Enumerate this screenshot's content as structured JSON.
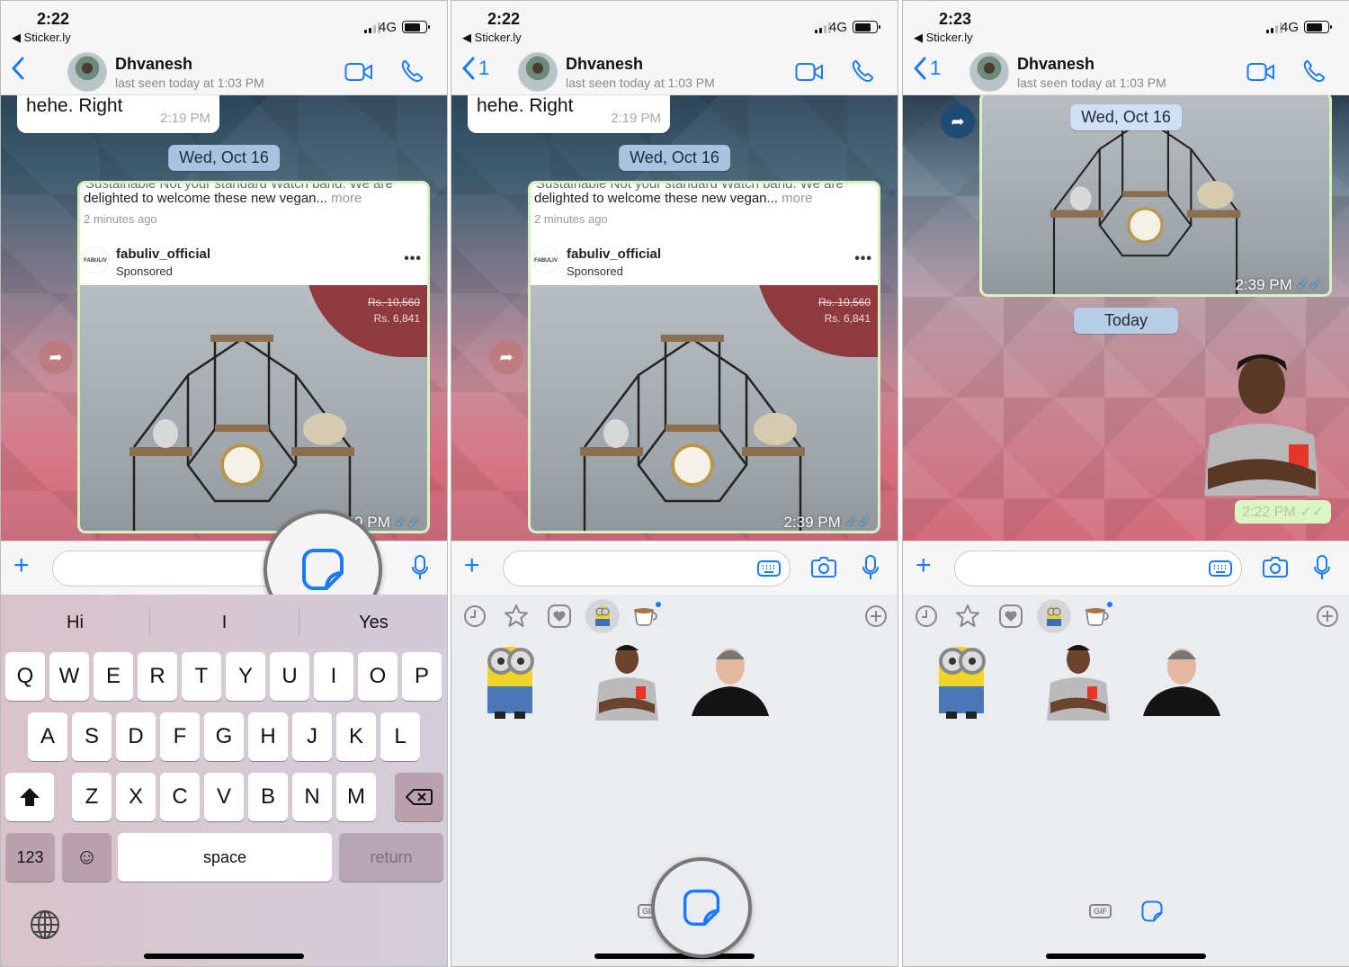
{
  "panels": [
    {
      "status": {
        "time": "2:22",
        "back_app": "◀ Sticker.ly",
        "network": "4G"
      },
      "header": {
        "back_label": "",
        "contact_name": "Dhvanesh",
        "last_seen": "last seen today at 1:03 PM"
      },
      "chat": {
        "incoming": {
          "text": "hehe. Right",
          "time": "2:19 PM"
        },
        "date_pill": "Wed, Oct 16",
        "card": {
          "cut_text": "Sustainable Not your standard Watch band. We are",
          "description": "delighted to welcome these new vegan...",
          "more": " more",
          "ago": "2 minutes ago",
          "logo_text": "FABULIV",
          "account": "fabuliv_official",
          "sponsored": "Sponsored",
          "menu": "•••",
          "old_price": "Rs. 10,560",
          "new_price": "Rs. 6,841",
          "time": "2:39 PM",
          "ticks": "✓✓"
        }
      },
      "input": {
        "placeholder": "",
        "value": ""
      },
      "suggestions": [
        "Hi",
        "I",
        "Yes"
      ],
      "keyboard": {
        "row1": [
          "Q",
          "W",
          "E",
          "R",
          "T",
          "Y",
          "U",
          "I",
          "O",
          "P"
        ],
        "row2": [
          "A",
          "S",
          "D",
          "F",
          "G",
          "H",
          "J",
          "K",
          "L"
        ],
        "row3": [
          "Z",
          "X",
          "C",
          "V",
          "B",
          "N",
          "M"
        ],
        "numbers": "123",
        "space": "space",
        "return": "return"
      }
    },
    {
      "status": {
        "time": "2:22",
        "back_app": "◀ Sticker.ly",
        "network": "4G"
      },
      "header": {
        "back_label": "1",
        "contact_name": "Dhvanesh",
        "last_seen": "last seen today at 1:03 PM"
      },
      "chat": {
        "incoming": {
          "text": "hehe. Right",
          "time": "2:19 PM"
        },
        "date_pill": "Wed, Oct 16",
        "card": {
          "cut_text": "Sustainable Not your standard Watch band. We are",
          "description": "delighted to welcome these new vegan...",
          "more": " more",
          "ago": "2 minutes ago",
          "logo_text": "FABULIV",
          "account": "fabuliv_official",
          "sponsored": "Sponsored",
          "menu": "•••",
          "old_price": "Rs. 10,560",
          "new_price": "Rs. 6,841",
          "time": "2:39 PM",
          "ticks": "✓✓"
        }
      },
      "input": {
        "placeholder": "",
        "value": ""
      },
      "sticker_tray": {
        "tabs": [
          "recent-icon",
          "favorites-star-icon",
          "heart-icon",
          "minion-pack",
          "teacup-pack",
          "add-pack-icon"
        ],
        "stickers": [
          "minion-sticker",
          "man-crossed-arms-sticker",
          "smiling-man-sticker"
        ]
      },
      "bottom_tabs": {
        "gif": "GIF"
      }
    },
    {
      "status": {
        "time": "2:23",
        "back_app": "◀ Sticker.ly",
        "network": "4G"
      },
      "header": {
        "back_label": "1",
        "contact_name": "Dhvanesh",
        "last_seen": "last seen today at 1:03 PM"
      },
      "chat": {
        "date_pill": "Wed, Oct 16",
        "card": {
          "time": "2:39 PM",
          "ticks": "✓✓"
        },
        "today_pill": "Today",
        "sent_sticker_time": "2:22 PM",
        "sent_ticks": "✓✓"
      },
      "input": {
        "placeholder": "",
        "value": ""
      },
      "sticker_tray": {
        "tabs": [
          "recent-icon",
          "favorites-star-icon",
          "heart-icon",
          "minion-pack",
          "teacup-pack",
          "add-pack-icon"
        ],
        "stickers": [
          "minion-sticker",
          "man-crossed-arms-sticker",
          "smiling-man-sticker"
        ]
      },
      "bottom_tabs": {
        "gif": "GIF"
      }
    }
  ],
  "colors": {
    "accent": "#1a7af8",
    "outgoing_bubble": "#dbf5c4",
    "date_pill": "#a8c3e0",
    "price_tag": "#8e3a3e"
  }
}
